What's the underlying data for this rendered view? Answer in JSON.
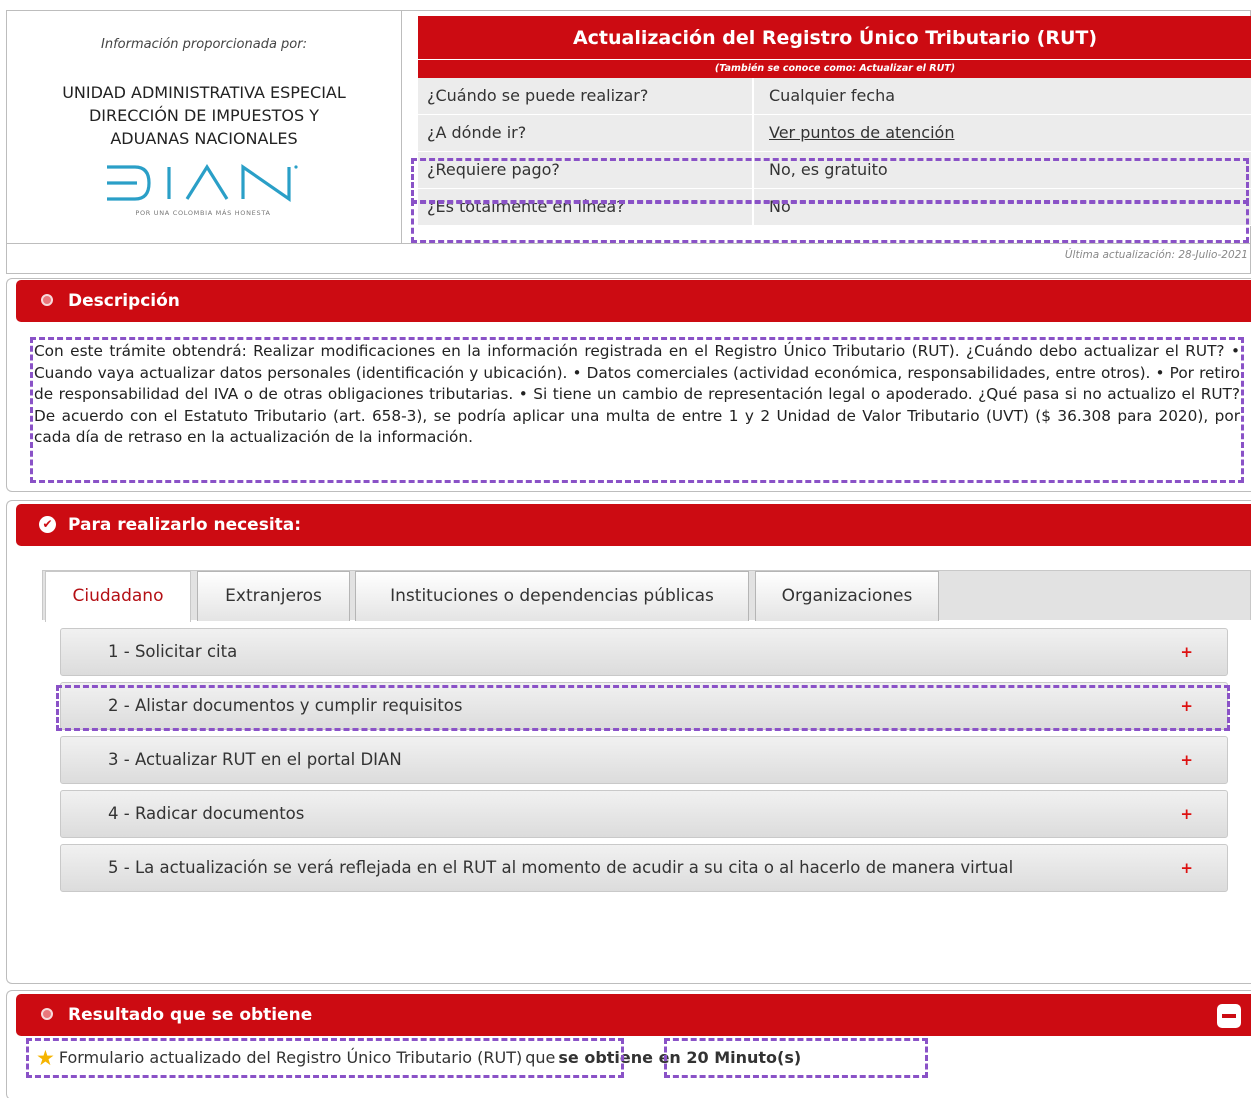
{
  "provider": {
    "intro": "Información proporcionada por:",
    "entity_line1": "UNIDAD ADMINISTRATIVA ESPECIAL",
    "entity_line2": "DIRECCIÓN DE IMPUESTOS Y",
    "entity_line3": "ADUANAS NACIONALES",
    "logo_text": "DIAN",
    "slogan": "POR UNA COLOMBIA MÁS HONESTA"
  },
  "procedure": {
    "title": "Actualización del Registro Único Tributario (RUT)",
    "subtitle": "(También se conoce como: Actualizar el RUT)",
    "rows": [
      {
        "question": "¿Cuándo se puede realizar?",
        "answer": "Cualquier fecha"
      },
      {
        "question": "¿A dónde ir?",
        "answer": "Ver puntos de atención"
      },
      {
        "question": "¿Requiere pago?",
        "answer": "No, es gratuito"
      },
      {
        "question": "¿Es totalmente en línea?",
        "answer": "No"
      }
    ],
    "last_update": "Última actualización: 28-Julio-2021"
  },
  "description": {
    "header": "Descripción",
    "text": "Con este trámite obtendrá: Realizar modificaciones en la información registrada en el Registro Único Tributario (RUT). ¿Cuándo debo actualizar el RUT? • Cuando vaya actualizar datos personales (identificación y ubicación). • Datos comerciales (actividad económica, responsabilidades, entre otros). • Por retiro de responsabilidad del IVA o de otras obligaciones tributarias. • Si tiene un cambio de representación legal o apoderado. ¿Qué pasa si no actualizo el RUT? De acuerdo con el Estatuto Tributario (art. 658-3), se podría aplicar una multa de entre 1 y 2 Unidad de Valor Tributario (UVT) ($ 36.308 para 2020), por cada día de retraso en la actualización de la información."
  },
  "requirements": {
    "header": "Para realizarlo necesita:",
    "tabs": [
      "Ciudadano",
      "Extranjeros",
      "Instituciones o dependencias públicas",
      "Organizaciones"
    ],
    "active_tab": "Ciudadano",
    "steps": [
      "1 - Solicitar cita",
      "2 - Alistar documentos y cumplir requisitos",
      "3 - Actualizar RUT en el portal DIAN",
      "4 - Radicar documentos",
      "5 - La actualización se verá reflejada en el RUT al momento de acudir a su cita o al hacerlo de manera virtual"
    ],
    "expand_symbol": "+"
  },
  "result": {
    "header": "Resultado que se obtiene",
    "item": "Formulario actualizado del Registro Único Tributario (RUT)",
    "connector": "que",
    "time": "se obtiene en 20 Minuto(s)"
  },
  "colors": {
    "brand_red": "#cc0b12",
    "highlight_dash": "#8a52c7",
    "star": "#f5b400"
  },
  "icons": [
    "bullet-icon",
    "check-circle-icon",
    "plus-icon",
    "minus-icon",
    "star-icon"
  ]
}
